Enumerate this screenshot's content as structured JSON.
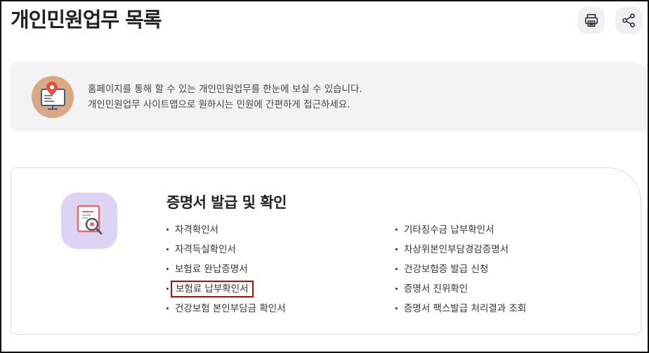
{
  "page": {
    "title": "개인민원업무 목록"
  },
  "toolbar": {
    "print_icon": "print-icon",
    "share_icon": "share-icon"
  },
  "intro": {
    "line1": "홈페이지를 통해 할 수 있는 개인민원업무를 한눈에 보실 수 있습니다.",
    "line2": "개인민원업무 사이트맵으로 원하시는 민원에 간편하게 접근하세요.",
    "icon": "monitor-location-icon"
  },
  "section": {
    "title": "증명서 발급 및 확인",
    "icon": "certificate-search-icon",
    "left_items": [
      "자격확인서",
      "자격득실확인서",
      "보험료 완납증명서",
      "보험료 납부확인서",
      "건강보험 본인부담금 확인서"
    ],
    "right_items": [
      "기타징수금 납부확인서",
      "차상위본인부담경감증명서",
      "건강보험증 발급 신청",
      "증명서 진위확인",
      "증명서 팩스발급 처리결과 조회"
    ]
  },
  "colors": {
    "highlight_border": "#d40000",
    "intro_bg": "#f3f3f3",
    "icon_lavender": "#ddd3f5",
    "icon_tan": "#d9a985"
  }
}
